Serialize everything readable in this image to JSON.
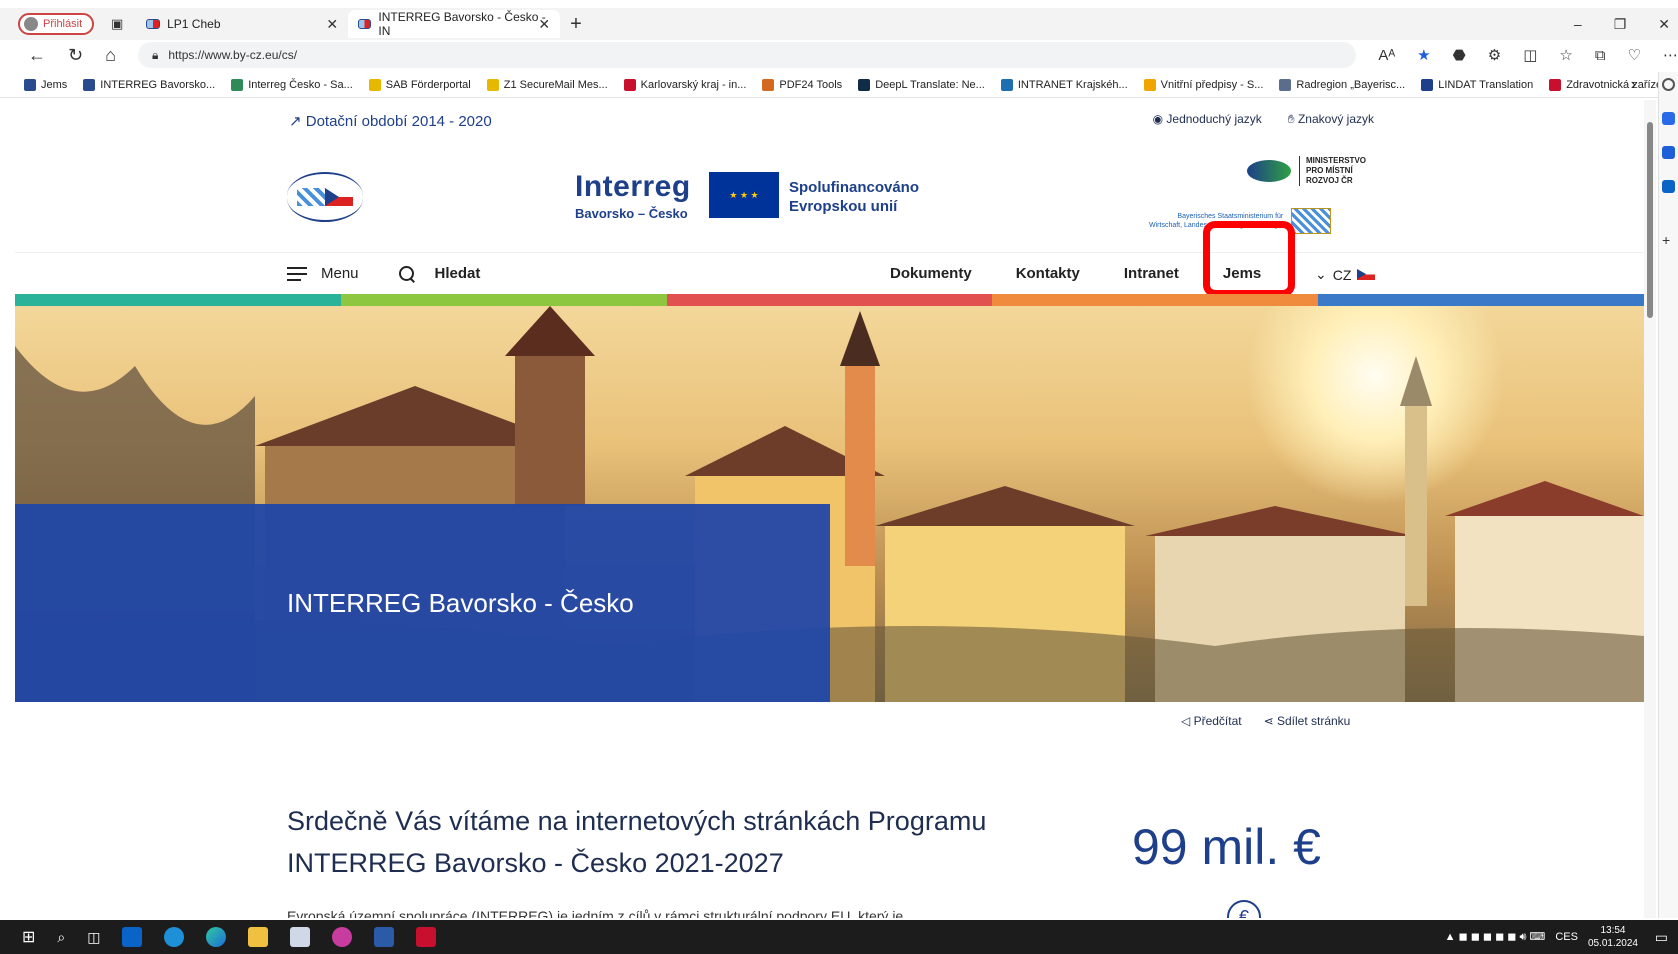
{
  "browser": {
    "profile_label": "Přihlásit",
    "tabs": [
      {
        "title": "LP1 Cheb"
      },
      {
        "title": "INTERREG Bavorsko - Česko - IN"
      }
    ],
    "url": "https://www.by-cz.eu/cs/",
    "bookmarks": [
      {
        "label": "Jems",
        "color": "#2a4c8e"
      },
      {
        "label": "INTERREG Bavorsko...",
        "color": "#2a4c8e"
      },
      {
        "label": "Interreg Česko - Sa...",
        "color": "#2e8b57"
      },
      {
        "label": "SAB Förderportal",
        "color": "#e6b800"
      },
      {
        "label": "Z1 SecureMail Mes...",
        "color": "#e6b800"
      },
      {
        "label": "Karlovarský kraj - in...",
        "color": "#c8102e"
      },
      {
        "label": "PDF24 Tools",
        "color": "#d2691e"
      },
      {
        "label": "DeepL Translate: Ne...",
        "color": "#0f2b46"
      },
      {
        "label": "INTRANET Krajskéh...",
        "color": "#1e6fb0"
      },
      {
        "label": "Vnitřní předpisy - S...",
        "color": "#f0a500"
      },
      {
        "label": "Radregion „Bayerisc...",
        "color": "#5a6d8c"
      },
      {
        "label": "LINDAT Translation",
        "color": "#1e3f8a"
      },
      {
        "label": "Zdravotnická zaříze...",
        "color": "#c8102e"
      }
    ]
  },
  "site": {
    "top_link": "↗ Dotační období 2014 - 2020",
    "lang_links": [
      "Jednoduchý jazyk",
      "Znakový jazyk"
    ],
    "logo": {
      "interreg": "Interreg",
      "region": "Bavorsko – Česko",
      "cofinanced": "Spolufinancováno",
      "cofinanced2": "Evropskou unií",
      "mmr": "MINISTERSTVO",
      "mmr2": "PRO MÍSTNÍ",
      "mmr3": "ROZVOJ ČR",
      "bav": "Bayerisches Staatsministerium für",
      "bav2": "Wirtschaft, Landesentwicklung und Energie"
    },
    "nav": {
      "menu": "Menu",
      "search": "Hledat",
      "items": [
        "Dokumenty",
        "Kontakty",
        "Intranet",
        "Jems"
      ],
      "lang": "CZ"
    },
    "color_bar": [
      "#2bb39a",
      "#8dc63f",
      "#e0514f",
      "#f08a3c",
      "#3a78c8"
    ],
    "hero_title": "INTERREG Bavorsko - Česko",
    "share": [
      "Předčítat",
      "Sdílet stránku"
    ],
    "welcome": "Srdečně Vás vítáme na internetových stránkách Programu INTERREG Bavorsko - Česko 2021-2027",
    "intro": "Evropská územní spolupráce (INTERREG) je jedním z cílů v rámci strukturální podpory EU, který je",
    "stat": "99 mil. €"
  },
  "taskbar": {
    "lang": "CES",
    "time": "13:54",
    "date": "05.01.2024"
  }
}
